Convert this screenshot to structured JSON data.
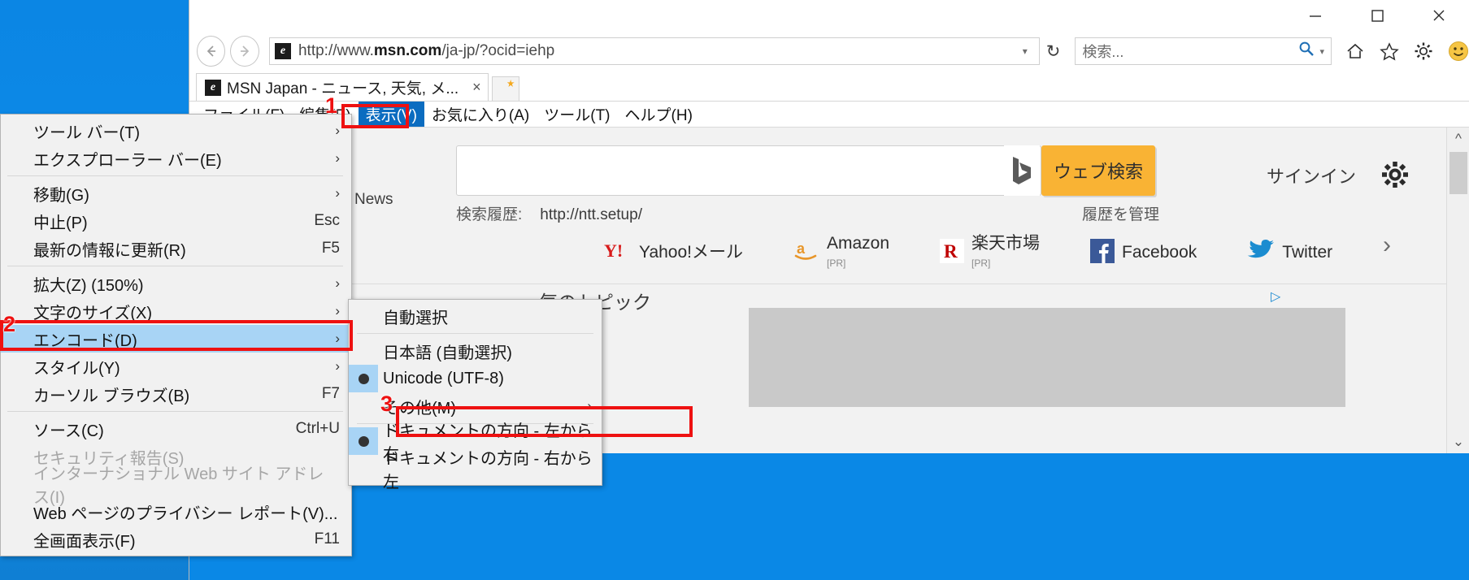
{
  "window": {
    "controls": {
      "minimize": "minimize-icon",
      "maximize": "maximize-icon",
      "close": "close-icon"
    }
  },
  "address_bar": {
    "back": "back-icon",
    "forward": "forward-icon",
    "favicon_letter": "e",
    "url_prefix": "http://www.",
    "url_bold": "msn.com",
    "url_suffix": "/ja-jp/?ocid=iehp",
    "dropdown": "▾",
    "refresh": "↻",
    "search_placeholder": "検索...",
    "search_value": "",
    "magnifier": "search-icon",
    "icons": [
      "home-icon",
      "favorites-star-icon",
      "gear-icon",
      "smiley-icon"
    ]
  },
  "tabs": {
    "items": [
      {
        "title": "MSN Japan - ニュース, 天気, メ...",
        "close": "×"
      }
    ],
    "new_tab": "new-tab-button"
  },
  "menubar": {
    "items": [
      {
        "label": "ファイル(F)",
        "active": false
      },
      {
        "label": "編集(E)",
        "active": false
      },
      {
        "label": "表示(V)",
        "active": true
      },
      {
        "label": "お気に入り(A)",
        "active": false
      },
      {
        "label": "ツール(T)",
        "active": false
      },
      {
        "label": "ヘルプ(H)",
        "active": false
      }
    ]
  },
  "view_menu": {
    "items": [
      {
        "label": "ツール バー(T)",
        "accel": "",
        "chevron": true,
        "highlight": false,
        "disabled": false
      },
      {
        "label": "エクスプローラー バー(E)",
        "accel": "",
        "chevron": true,
        "highlight": false,
        "disabled": false
      },
      {
        "separator": true
      },
      {
        "label": "移動(G)",
        "accel": "",
        "chevron": true,
        "highlight": false,
        "disabled": false
      },
      {
        "label": "中止(P)",
        "accel": "Esc",
        "chevron": false,
        "highlight": false,
        "disabled": false
      },
      {
        "label": "最新の情報に更新(R)",
        "accel": "F5",
        "chevron": false,
        "highlight": false,
        "disabled": false
      },
      {
        "separator": true
      },
      {
        "label": "拡大(Z) (150%)",
        "accel": "",
        "chevron": true,
        "highlight": false,
        "disabled": false
      },
      {
        "label": "文字のサイズ(X)",
        "accel": "",
        "chevron": true,
        "highlight": false,
        "disabled": false
      },
      {
        "label": "エンコード(D)",
        "accel": "",
        "chevron": true,
        "highlight": true,
        "disabled": false
      },
      {
        "label": "スタイル(Y)",
        "accel": "",
        "chevron": true,
        "highlight": false,
        "disabled": false
      },
      {
        "label": "カーソル ブラウズ(B)",
        "accel": "F7",
        "chevron": false,
        "highlight": false,
        "disabled": false
      },
      {
        "separator": true
      },
      {
        "label": "ソース(C)",
        "accel": "Ctrl+U",
        "chevron": false,
        "highlight": false,
        "disabled": false
      },
      {
        "label": "セキュリティ報告(S)",
        "accel": "",
        "chevron": false,
        "highlight": false,
        "disabled": true
      },
      {
        "label": "インターナショナル Web サイト アドレス(I)",
        "accel": "",
        "chevron": false,
        "highlight": false,
        "disabled": true
      },
      {
        "label": "Web ページのプライバシー レポート(V)...",
        "accel": "",
        "chevron": false,
        "highlight": false,
        "disabled": false
      },
      {
        "label": "全画面表示(F)",
        "accel": "F11",
        "chevron": false,
        "highlight": false,
        "disabled": false
      }
    ]
  },
  "encoding_submenu": {
    "items": [
      {
        "label": "自動選択",
        "selected": false,
        "chevron": false
      },
      {
        "separator": true
      },
      {
        "label": "日本語 (自動選択)",
        "selected": false,
        "chevron": false
      },
      {
        "label": "Unicode (UTF-8)",
        "selected": true,
        "chevron": false
      },
      {
        "label": "その他(M)",
        "selected": false,
        "chevron": true
      },
      {
        "separator": true
      },
      {
        "label": "ドキュメントの方向 - 左から右",
        "selected": true,
        "chevron": false
      },
      {
        "label": "ドキュメントの方向 - 右から左",
        "selected": false,
        "chevron": false
      }
    ]
  },
  "page": {
    "left_label": "News",
    "search_value": "",
    "bing_logo": "bing-icon",
    "web_search_button": "ウェブ検索",
    "history_label": "検索履歴:",
    "history_value": "http://ntt.setup/",
    "manage_history": "履歴を管理",
    "sign_in": "サインイン",
    "settings_icon": "gear-icon",
    "quicklinks": [
      {
        "name": "Yahoo!メール",
        "pr": "",
        "icon": "yahoo-icon"
      },
      {
        "name": "Amazon",
        "pr": "[PR]",
        "icon": "amazon-icon"
      },
      {
        "name": "楽天市場",
        "pr": "[PR]",
        "icon": "rakuten-icon"
      },
      {
        "name": "Facebook",
        "pr": "",
        "icon": "facebook-icon"
      },
      {
        "name": "Twitter",
        "pr": "",
        "icon": "twitter-icon"
      }
    ],
    "next_arrow": "chevron-right-icon",
    "topics_title": "気のトピック",
    "ad_marker": "▷"
  },
  "annotations": {
    "steps": [
      {
        "num": "1"
      },
      {
        "num": "2"
      },
      {
        "num": "3"
      }
    ]
  },
  "colors": {
    "accent_blue": "#0b6cc0",
    "highlight_blue": "#a8d4f5",
    "annotation_red": "#ee1111",
    "bing_orange": "#f9b334",
    "desktop_blue": "#0a88e6"
  }
}
